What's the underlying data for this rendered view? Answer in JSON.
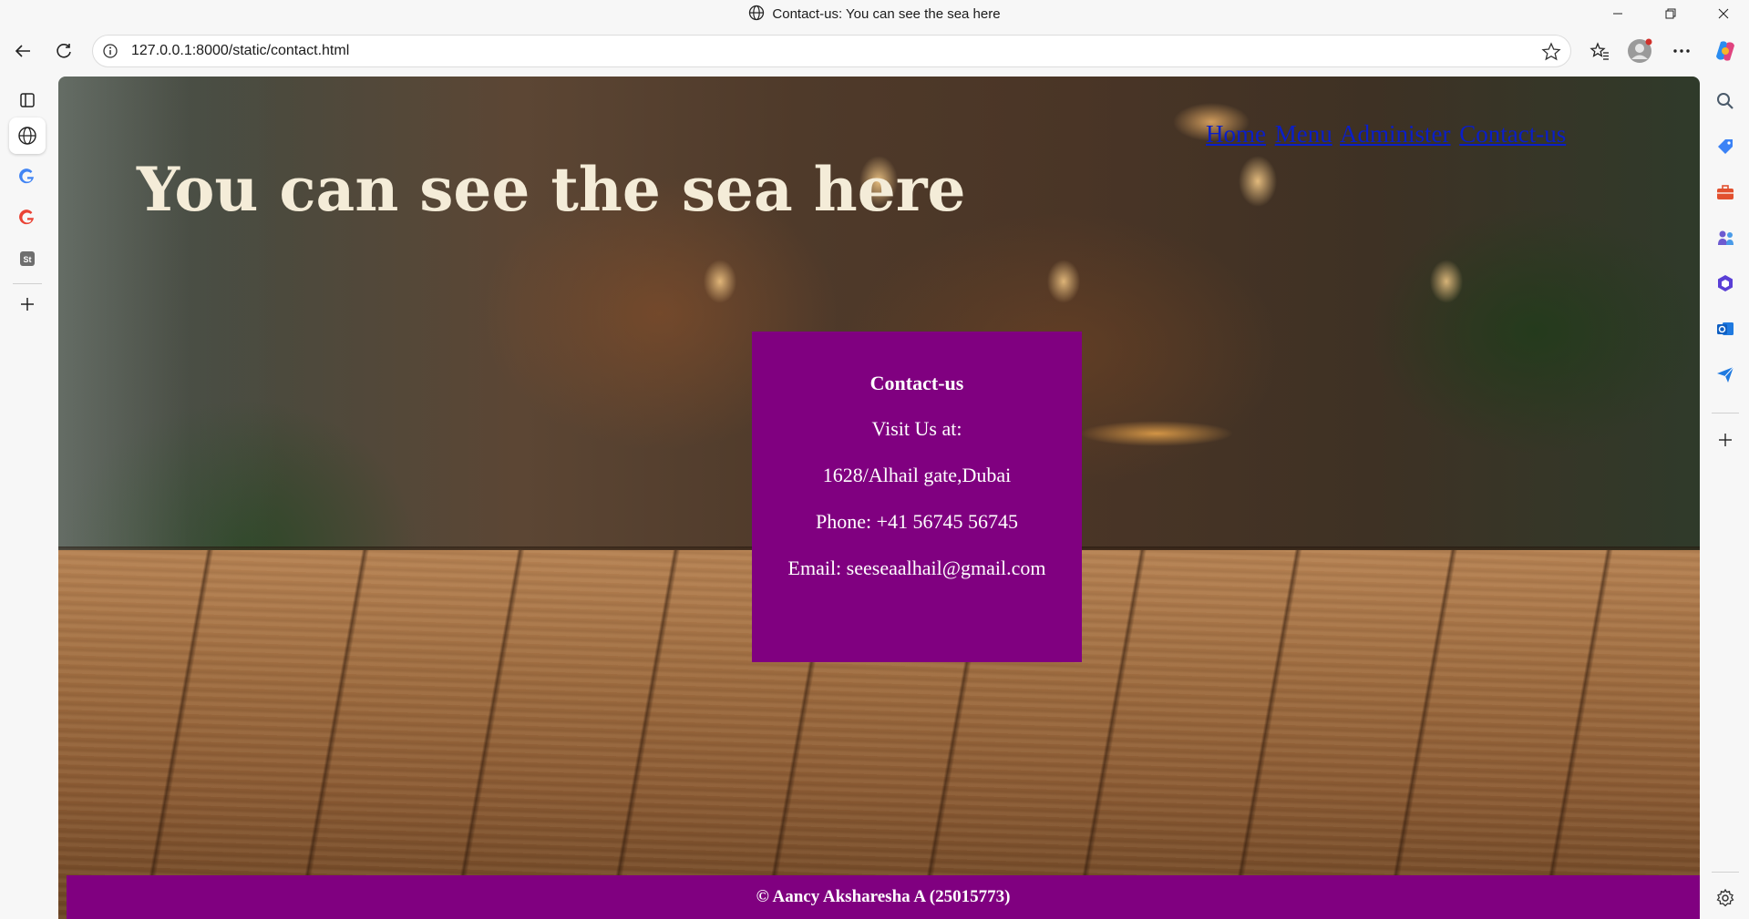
{
  "window": {
    "title": "Contact-us: You can see the sea here"
  },
  "toolbar": {
    "url": "127.0.0.1:8000/static/contact.html"
  },
  "page": {
    "site_title": "You can see the sea here",
    "nav": [
      {
        "label": "Home"
      },
      {
        "label": "Menu"
      },
      {
        "label": "Administer"
      },
      {
        "label": "Contact-us"
      }
    ],
    "contact": {
      "heading": "Contact-us",
      "visit": "Visit Us at:",
      "address": "1628/Alhail gate,Dubai",
      "phone": "Phone: +41 56745 56745",
      "email": "Email: seeseaalhail@gmail.com"
    },
    "footer": "© Aancy Aksharesha A (25015773)"
  },
  "colors": {
    "accent_purple": "#800080",
    "link_blue": "#0a1ec8",
    "title_cream": "#f4ecd8"
  },
  "icons": {
    "left_sidebar": [
      "tab-actions-icon",
      "globe-icon",
      "google-icon",
      "google-icon",
      "st-icon",
      "add-icon"
    ],
    "right_sidebar": [
      "search-icon",
      "tag-icon",
      "toolbox-icon",
      "chess-icon",
      "office-icon",
      "outlook-icon",
      "send-icon",
      "add-icon",
      "settings-icon"
    ]
  }
}
